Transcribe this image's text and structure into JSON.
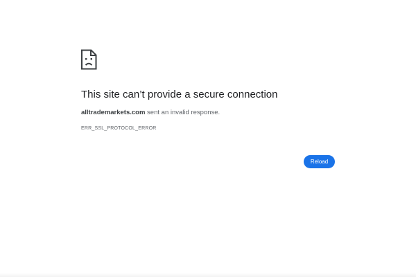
{
  "error_page": {
    "icon": "sad-document-icon",
    "title": "This site can’t provide a secure connection",
    "host": "alltrademarkets.com",
    "description_suffix": " sent an invalid response.",
    "error_code": "ERR_SSL_PROTOCOL_ERROR",
    "reload_label": "Reload"
  },
  "colors": {
    "background": "#ffffff",
    "title_text": "#202124",
    "body_text": "#5f6368",
    "button_bg": "#1a73e8",
    "button_text": "#ffffff",
    "icon_stroke": "#3c4043"
  }
}
